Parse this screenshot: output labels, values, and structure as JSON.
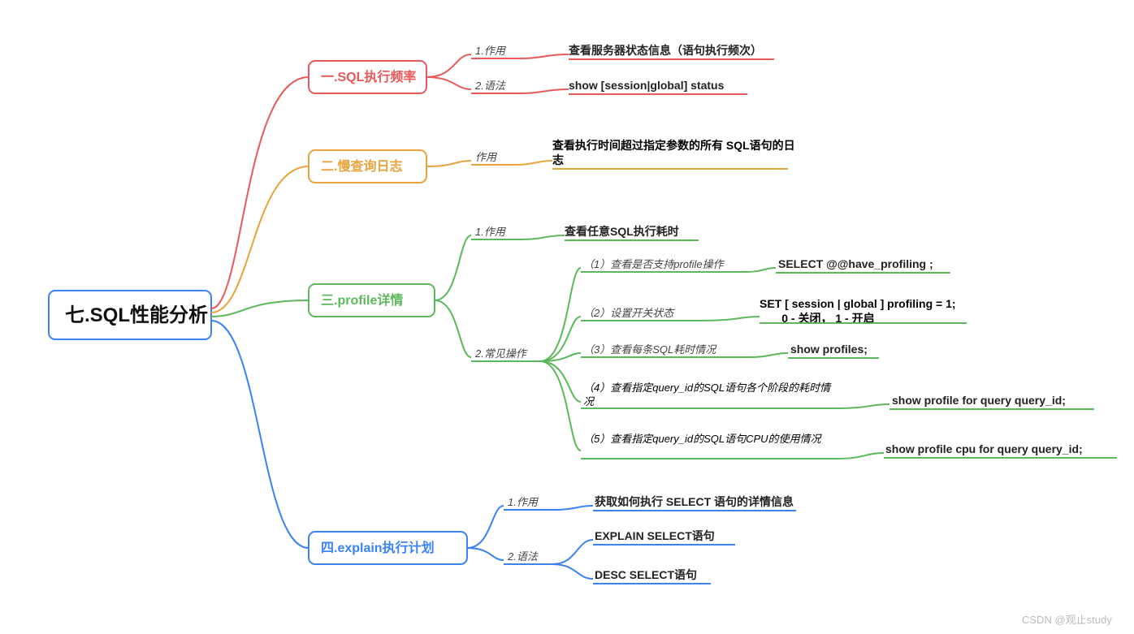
{
  "root": {
    "title": "七.SQL性能分析"
  },
  "branches": [
    {
      "id": "b1",
      "label": "一.SQL执行频率",
      "color": "#e85a5a",
      "children": [
        {
          "label": "1.作用",
          "value": "查看服务器状态信息（语句执行频次）"
        },
        {
          "label": "2.语法",
          "value": "show [session|global] status"
        }
      ]
    },
    {
      "id": "b2",
      "label": "二.慢查询日志",
      "color": "#e8a33c",
      "children": [
        {
          "label": "作用",
          "value": "查看执行时间超过指定参数的所有 SQL语句的日志"
        }
      ]
    },
    {
      "id": "b3",
      "label": "三.profile详情",
      "color": "#5bb85b",
      "children": [
        {
          "label": "1.作用",
          "value": "查看任意SQL执行耗时"
        },
        {
          "label": "2.常见操作",
          "children": [
            {
              "label": "（1）查看是否支持profile操作",
              "value": "SELECT  @@have_profiling ;"
            },
            {
              "label": "（2）设置开关状态",
              "value": "SET [ session | global ]  profiling = 1;",
              "extra": "0 - 关闭， 1 - 开启"
            },
            {
              "label": "（3）查看每条SQL耗时情况",
              "value": "show profiles;"
            },
            {
              "label": "（4）查看指定query_id的SQL语句各个阶段的耗时情况",
              "value": "show profile for query query_id;"
            },
            {
              "label": "（5）查看指定query_id的SQL语句CPU的使用情况",
              "value": "show profile cpu for query query_id;"
            }
          ]
        }
      ]
    },
    {
      "id": "b4",
      "label": "四.explain执行计划",
      "color": "#3b82f6",
      "children": [
        {
          "label": "1.作用",
          "value": "获取如何执行 SELECT 语句的详情信息"
        },
        {
          "label": "2.语法",
          "children": [
            {
              "label": "",
              "value": "EXPLAIN   SELECT语句"
            },
            {
              "label": "",
              "value": "DESC SELECT语句"
            }
          ]
        }
      ]
    }
  ],
  "watermark": "CSDN @观止study"
}
